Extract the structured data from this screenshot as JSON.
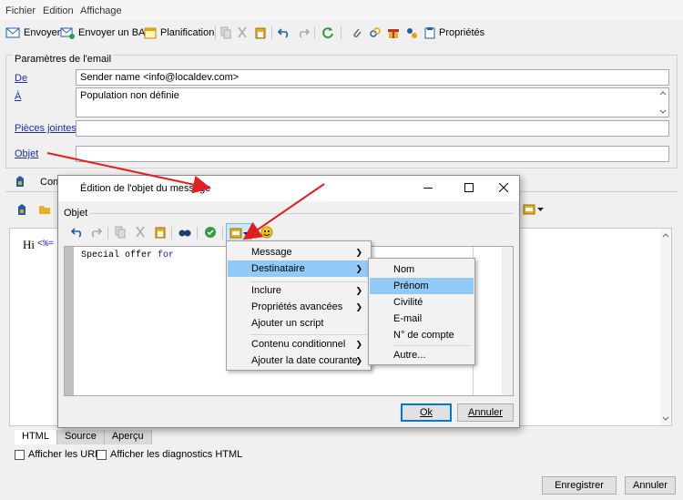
{
  "menubar": {
    "items": [
      "Fichier",
      "Edition",
      "Affichage"
    ]
  },
  "toolbar": {
    "send": "Envoyer",
    "send_proof": "Envoyer un BAT",
    "planning": "Planification",
    "properties": "Propriétés"
  },
  "email_params": {
    "legend": "Paramètres de l'email",
    "from_label": "De",
    "from_value": "Sender name <info@localdev.com>",
    "to_label": "À",
    "to_value": "Population non définie",
    "attachments_label": "Pièces jointes",
    "attachments_value": "",
    "subject_label": "Objet",
    "subject_value": ""
  },
  "content": {
    "tab_label": "Cont",
    "editor_text": "Hi",
    "editor_tag": "<%=",
    "bottom_tabs": [
      "HTML",
      "Source",
      "Aperçu"
    ],
    "show_urls": "Afficher les URL",
    "show_diag": "Afficher les diagnostics HTML"
  },
  "footer": {
    "save": "Enregistrer",
    "cancel": "Annuler"
  },
  "dialog": {
    "title": "Édition de l'objet du message",
    "section": "Objet",
    "text": "Special offer ",
    "text_keyword": "for",
    "ok": "Ok",
    "cancel": "Annuler"
  },
  "context_menu": {
    "items": [
      {
        "label": "Message",
        "submenu": true
      },
      {
        "label": "Destinataire",
        "submenu": true,
        "highlighted": true
      },
      {
        "label": "Inclure",
        "submenu": true
      },
      {
        "label": "Propriétés avancées",
        "submenu": true
      },
      {
        "label": "Ajouter un script",
        "submenu": false
      },
      {
        "label": "Contenu conditionnel",
        "submenu": true
      },
      {
        "label": "Ajouter la date courante",
        "submenu": true
      }
    ]
  },
  "submenu": {
    "items": [
      {
        "label": "Nom"
      },
      {
        "label": "Prénom",
        "highlighted": true
      },
      {
        "label": "Civilité"
      },
      {
        "label": "E-mail"
      },
      {
        "label": "N° de compte"
      },
      {
        "label": "Autre..."
      }
    ]
  },
  "colors": {
    "link": "#1a2fb5",
    "highlight": "#91c9f7",
    "annotation_arrow": "#e02020",
    "code_keyword": "#1a1ad0"
  }
}
